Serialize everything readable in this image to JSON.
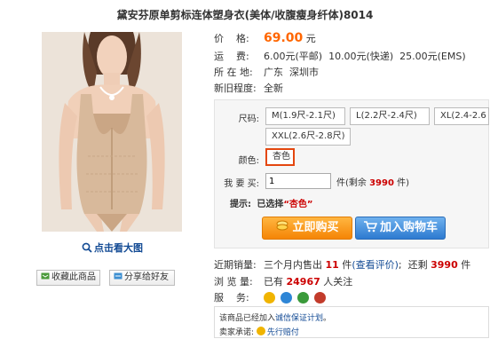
{
  "product": {
    "title": "黛安芬原单剪标连体塑身衣(美体/收腹瘦身纤体)8014"
  },
  "gallery": {
    "zoom_label": "点击看大图"
  },
  "actions": {
    "favorite_label": "收藏此商品",
    "share_label": "分享给好友"
  },
  "info": {
    "price_label": "价    格:",
    "price_value": "69.00",
    "price_unit": "元",
    "shipping_label": "运    费:",
    "shipping_value": "6.00元(平邮)  10.00元(快递)  25.00元(EMS)",
    "location_label": "所 在 地:",
    "location_value": "广东  深圳市",
    "condition_label": "新旧程度:",
    "condition_value": "全新"
  },
  "options": {
    "size_label": "尺码:",
    "sizes": [
      "M(1.9尺-2.1尺)",
      "L(2.2尺-2.4尺)",
      "XL(2.4-2.6",
      "XXL(2.6尺-2.8尺)"
    ],
    "color_label": "颜色:",
    "color_value": "杏色",
    "qty_label": "我 要 买:",
    "qty_value": "1",
    "qty_unit_prefix": "件(剩余",
    "stock": "3990",
    "qty_unit_suffix": "件)",
    "tip_label": "提示:",
    "tip_text": "已选择",
    "tip_value": "“杏色”",
    "buy_label": "立即购买",
    "cart_label": "加入购物车"
  },
  "stats": {
    "recent_label": "近期销量:",
    "recent_prefix": "三个月内售出",
    "recent_count": "11",
    "recent_unit": "件",
    "review_link": "(查看评价)",
    "sep": ";  还剩",
    "remain": "3990",
    "remain_unit": "件",
    "views_label": "浏 览 量:",
    "views_prefix": "已有",
    "views_count": "24967",
    "views_suffix": "人关注",
    "service_label": "服    务:"
  },
  "promise": {
    "line1_prefix": "该商品已经加入",
    "line1_link": "诚信保证计划",
    "line1_suffix": "。",
    "line2_label": "卖家承诺:",
    "line2_link": "先行赔付"
  },
  "colors": {
    "price": "#ff6600",
    "link": "#124a94",
    "highlight": "#cc0000",
    "buy_button": "#f58505",
    "cart_button": "#2d7ad0",
    "selected_border": "#e4470f"
  }
}
